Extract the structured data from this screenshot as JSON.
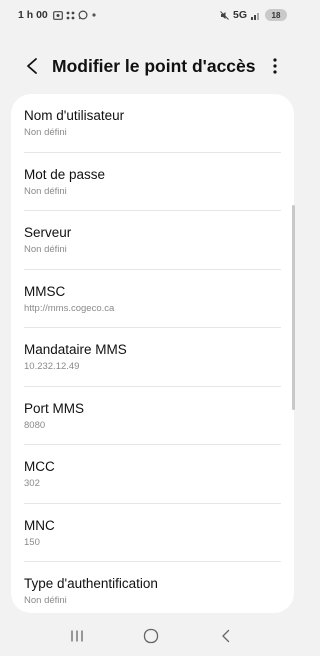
{
  "status_bar": {
    "time": "1 h 00",
    "network": "5G",
    "battery": "18"
  },
  "header": {
    "title": "Modifier le point d'accès"
  },
  "settings": [
    {
      "label": "Nom d'utilisateur",
      "value": "Non défini"
    },
    {
      "label": "Mot de passe",
      "value": "Non défini"
    },
    {
      "label": "Serveur",
      "value": "Non défini"
    },
    {
      "label": "MMSC",
      "value": "http://mms.cogeco.ca"
    },
    {
      "label": "Mandataire MMS",
      "value": "10.232.12.49"
    },
    {
      "label": "Port MMS",
      "value": "8080"
    },
    {
      "label": "MCC",
      "value": "302"
    },
    {
      "label": "MNC",
      "value": "150"
    },
    {
      "label": "Type d'authentification",
      "value": "Non défini"
    }
  ],
  "icons": {
    "back": "chevron-left-icon",
    "more": "more-vertical-icon",
    "nav_recents": "recents-icon",
    "nav_home": "home-icon",
    "nav_back": "nav-back-icon"
  },
  "colors": {
    "background": "#f2f2f2",
    "card": "#ffffff",
    "secondary_text": "#8a8a8a"
  }
}
